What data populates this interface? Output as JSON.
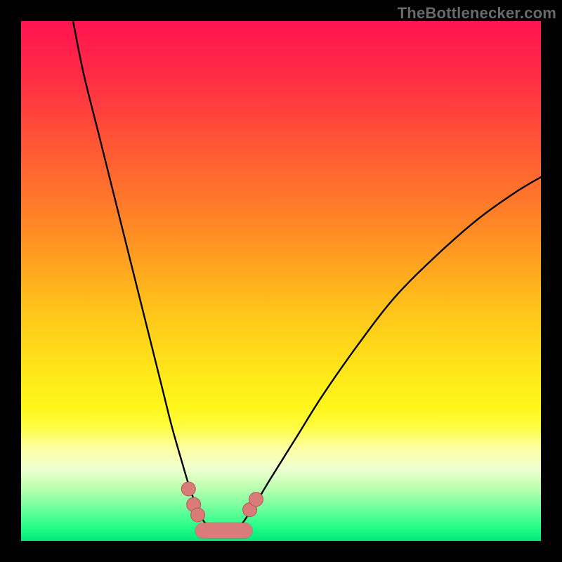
{
  "watermark": "TheBottlenecker.com",
  "colors": {
    "frame": "#000000",
    "curve": "#000000",
    "marker_fill": "#d97b78",
    "marker_stroke": "#b85450",
    "gradient_stops": [
      {
        "offset": 0.0,
        "color": "#ff1450"
      },
      {
        "offset": 0.1,
        "color": "#ff2a46"
      },
      {
        "offset": 0.25,
        "color": "#ff5a33"
      },
      {
        "offset": 0.4,
        "color": "#ff8a25"
      },
      {
        "offset": 0.55,
        "color": "#ffc21a"
      },
      {
        "offset": 0.68,
        "color": "#ffe81a"
      },
      {
        "offset": 0.74,
        "color": "#fff61a"
      },
      {
        "offset": 0.78,
        "color": "#fffc40"
      },
      {
        "offset": 0.82,
        "color": "#fdffa0"
      },
      {
        "offset": 0.86,
        "color": "#f1ffd0"
      },
      {
        "offset": 0.9,
        "color": "#b8ffb0"
      },
      {
        "offset": 0.94,
        "color": "#6aff9a"
      },
      {
        "offset": 0.97,
        "color": "#2cff8c"
      },
      {
        "offset": 1.0,
        "color": "#00e878"
      }
    ]
  },
  "chart_data": {
    "type": "line",
    "title": "",
    "xlabel": "",
    "ylabel": "",
    "xlim": [
      0,
      100
    ],
    "ylim": [
      0,
      100
    ],
    "grid": false,
    "series": [
      {
        "name": "left-branch",
        "x": [
          10,
          12,
          15,
          18,
          21,
          24,
          27,
          29,
          31,
          32.5,
          34,
          35,
          36.5
        ],
        "y": [
          100,
          90,
          78,
          66,
          54,
          42,
          30,
          22,
          15,
          10,
          6,
          4,
          2
        ]
      },
      {
        "name": "right-branch",
        "x": [
          41.5,
          43,
          45,
          48,
          53,
          58,
          65,
          72,
          80,
          88,
          95,
          100
        ],
        "y": [
          2,
          4,
          7,
          12,
          20,
          28,
          38,
          47,
          55,
          62,
          67,
          70
        ]
      },
      {
        "name": "valley-floor",
        "x": [
          36.5,
          37.5,
          39,
          40.5,
          41.5
        ],
        "y": [
          2,
          1.2,
          1,
          1.2,
          2
        ]
      }
    ],
    "markers": {
      "left_cluster": {
        "x": [
          32.2,
          33.2,
          34.0
        ],
        "y": [
          10,
          7,
          5
        ]
      },
      "right_cluster": {
        "x": [
          44.0,
          45.2
        ],
        "y": [
          6,
          8
        ]
      },
      "floor_segment": {
        "x_from": 35.0,
        "x_to": 43.0,
        "y": 2.0
      }
    }
  }
}
